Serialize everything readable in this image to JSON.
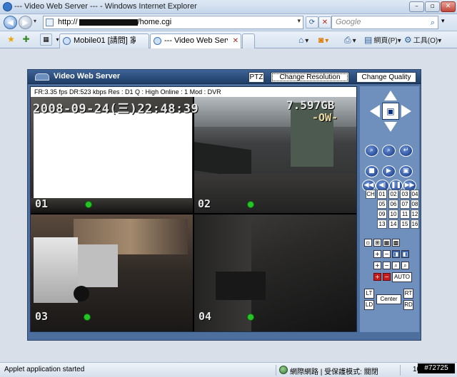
{
  "window": {
    "title": "--- Video Web Server --- - Windows Internet Explorer",
    "min": "–",
    "max": "▫",
    "close": "✕"
  },
  "address": {
    "url_prefix": "http://",
    "url_suffix": "/home.cgi"
  },
  "search": {
    "placeholder": "Google"
  },
  "tabs": [
    {
      "label": "Mobile01 [請問] 家中要安..."
    },
    {
      "label": "--- Video Web Server ..."
    }
  ],
  "toolbar": {
    "page_label": "網頁(P)",
    "tools_label": "工具(O)"
  },
  "app": {
    "title": "Video Web Server",
    "ptz_label": "PTZ",
    "change_resolution_label": "Change Resolution",
    "change_quality_label": "Change Quality",
    "info": "FR:3.35 fps  DR:523 kbps    Res : D1  Q : High  Online : 1 Mod : DVR",
    "timestamp": "2008-09-24(三)22:48:39",
    "disk": "7.597GB",
    "ow": "-OW-",
    "cams": [
      "01",
      "02",
      "03",
      "04"
    ]
  },
  "controls": {
    "ch_label": "CH",
    "channels": [
      "01",
      "02",
      "03",
      "04",
      "05",
      "06",
      "07",
      "08",
      "09",
      "10",
      "11",
      "12",
      "13",
      "14",
      "15",
      "16"
    ],
    "auto_label": "AUTO",
    "lt": "LT",
    "rt": "RT",
    "ld": "LD",
    "rd": "RD",
    "center": "Center"
  },
  "status": {
    "text": "Applet application started",
    "zone": "網際網路 | 受保護模式: 關閉",
    "zoom": "100%",
    "watermark": "#72725"
  }
}
